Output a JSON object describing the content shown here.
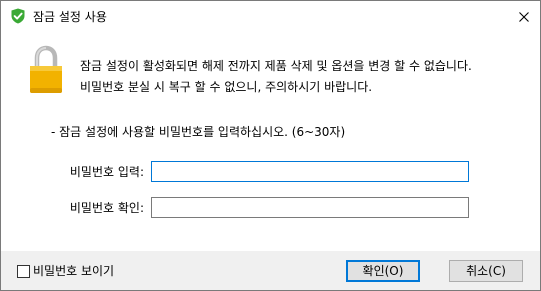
{
  "window": {
    "title": "잠금 설정 사용",
    "title_icon": "green-shield-check-icon",
    "close_icon": "close-icon"
  },
  "message": {
    "icon": "padlock-icon",
    "line1": "잠금 설정이 활성화되면 해제 전까지 제품 삭제 및 옵션을 변경 할 수 없습니다.",
    "line2": "비밀번호 분실 시 복구 할 수 없으니, 주의하시기 바랍니다."
  },
  "form": {
    "hint": "- 잠금 설정에 사용할 비밀번호를 입력하십시오. (6~30자)",
    "password_label": "비밀번호 입력:",
    "password_value": "",
    "confirm_label": "비밀번호 확인:",
    "confirm_value": ""
  },
  "footer": {
    "show_password_label": "비밀번호 보이기",
    "show_password_checked": false,
    "ok_label": "확인(O)",
    "cancel_label": "취소(C)"
  },
  "colors": {
    "accent": "#0078d7",
    "shield": "#3aa935",
    "lock_body": "#f2b200",
    "footer_bg": "#f0f0f0"
  }
}
